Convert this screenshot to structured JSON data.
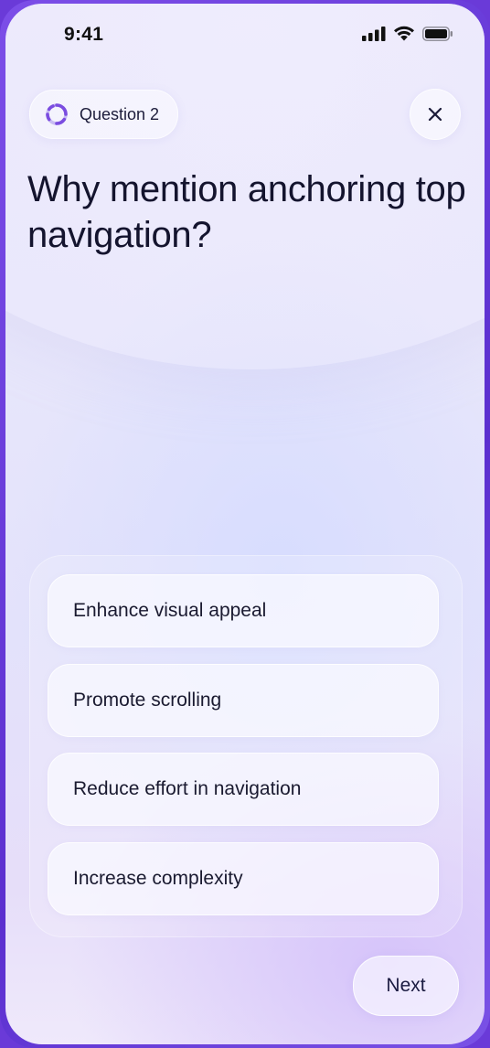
{
  "status_bar": {
    "time": "9:41",
    "icons": [
      "cellular-signal-icon",
      "wifi-icon",
      "battery-icon"
    ]
  },
  "header": {
    "progress_label": "Question 2",
    "progress_icon": "progress-ring-icon",
    "close_icon": "close-icon"
  },
  "question": {
    "text": "Why mention anchoring top navigation?"
  },
  "options": [
    {
      "label": "Enhance visual appeal"
    },
    {
      "label": "Promote scrolling"
    },
    {
      "label": "Reduce effort in navigation"
    },
    {
      "label": "Increase complexity"
    }
  ],
  "footer": {
    "next_label": "Next"
  },
  "colors": {
    "frame": "#6a3ad8",
    "accent": "#7b4de0",
    "text": "#14142e"
  }
}
